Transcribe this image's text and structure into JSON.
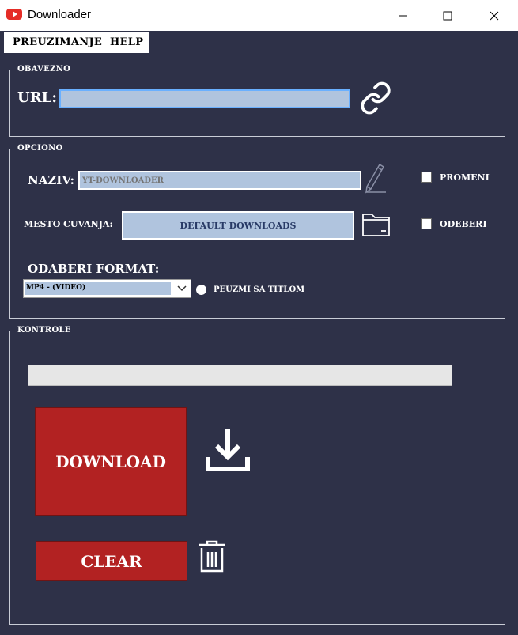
{
  "window": {
    "title": "Downloader"
  },
  "menu": {
    "items": [
      "PREUZIMANJE",
      "HELP"
    ]
  },
  "obavezno": {
    "title": "OBAVEZNO",
    "url_label": "URL:",
    "url_value": ""
  },
  "opciono": {
    "title": "OPCIONO",
    "naziv_label": "NAZIV:",
    "naziv_placeholder": "YT-DOWNLOADER",
    "promeni_label": "PROMENI",
    "mesto_label": "MESTO CUVANJA:",
    "mesto_button": "DEFAULT DOWNLOADS",
    "odeberi_label": "ODEBERI",
    "format_label": "ODABERI FORMAT:",
    "format_selected": "MP4 - (VIDEO)",
    "subtitle_label": "PEUZMI SA TITLOM"
  },
  "kontrole": {
    "title": "KONTROLE",
    "progress": 0,
    "download_label": "DOWNLOAD",
    "clear_label": "CLEAR"
  },
  "colors": {
    "background": "#2e3148",
    "accent_red": "#b22222",
    "field": "#b0c4de"
  }
}
